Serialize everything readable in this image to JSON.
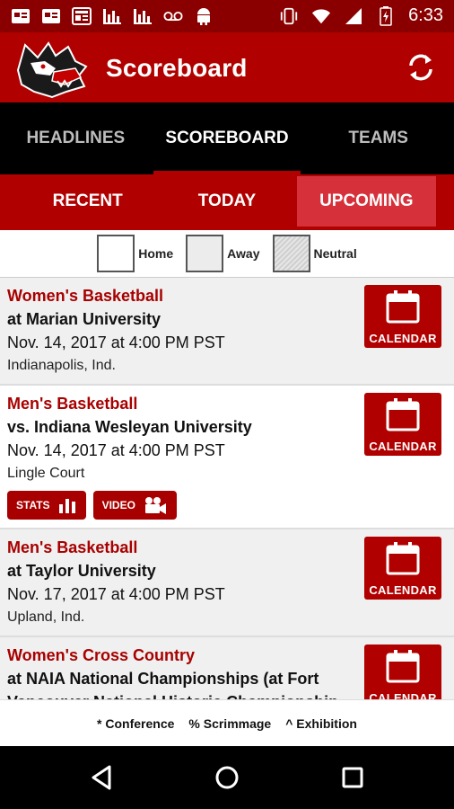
{
  "status_bar": {
    "time": "6:33",
    "left_icons": [
      "card-icon",
      "card-icon",
      "newspaper-icon",
      "chart-icon",
      "chart-icon",
      "voicemail-icon",
      "android-icon"
    ],
    "right_icons": [
      "vibrate-icon",
      "wifi-icon",
      "signal-icon",
      "battery-icon"
    ]
  },
  "app_bar": {
    "title": "Scoreboard",
    "logo": "wolf-logo",
    "refresh_icon": "refresh-icon"
  },
  "main_tabs": [
    {
      "label": "HEADLINES",
      "active": false
    },
    {
      "label": "SCOREBOARD",
      "active": true
    },
    {
      "label": "TEAMS",
      "active": false
    }
  ],
  "sub_tabs": [
    {
      "label": "RECENT",
      "active": false
    },
    {
      "label": "TODAY",
      "active": false
    },
    {
      "label": "UPCOMING",
      "active": true
    }
  ],
  "legend": {
    "home": "Home",
    "away": "Away",
    "neutral": "Neutral"
  },
  "games": [
    {
      "sport": "Women's Basketball",
      "opponent": "at Marian University",
      "datetime": "Nov. 14, 2017 at 4:00 PM PST",
      "location": "Indianapolis, Ind.",
      "type": "away",
      "calendar_label": "CALENDAR"
    },
    {
      "sport": "Men's Basketball",
      "opponent": "vs. Indiana Wesleyan University",
      "datetime": "Nov. 14, 2017 at 4:00 PM PST",
      "location": "Lingle Court",
      "type": "home",
      "calendar_label": "CALENDAR",
      "stats_label": "STATS",
      "video_label": "VIDEO"
    },
    {
      "sport": "Men's Basketball",
      "opponent": "at Taylor University",
      "datetime": "Nov. 17, 2017 at 4:00 PM PST",
      "location": "Upland, Ind.",
      "type": "away",
      "calendar_label": "CALENDAR"
    },
    {
      "sport": "Women's Cross Country",
      "opponent": "at NAIA National Championships (at Fort Vancouver National Historic Championship Course)",
      "datetime": "",
      "location": "",
      "type": "away",
      "calendar_label": "CALENDAR"
    }
  ],
  "footer": {
    "conference": "* Conference",
    "scrimmage": "% Scrimmage",
    "exhibition": "^ Exhibition"
  },
  "colors": {
    "status_bar": "#8a0000",
    "primary": "#b00000",
    "active_subtab": "#d6303a",
    "away_bg": "#f0f0f0"
  }
}
